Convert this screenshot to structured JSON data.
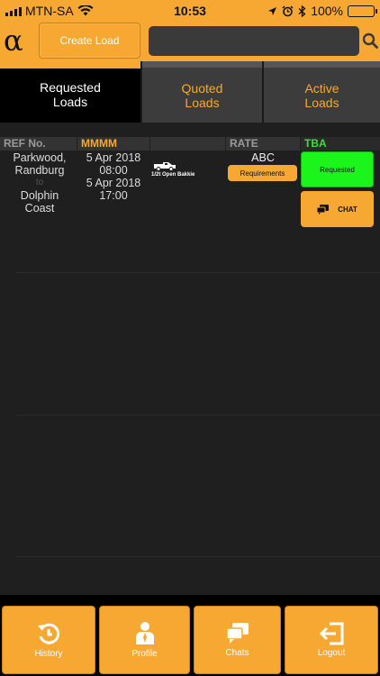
{
  "status_bar": {
    "carrier": "MTN-SA",
    "time": "10:53",
    "battery": "100%",
    "battery_level": 1.0
  },
  "header": {
    "logo": "α",
    "create_label": "Create Load",
    "search_placeholder": ""
  },
  "tabs": [
    {
      "label": "Requested Loads"
    },
    {
      "label": "Quoted Loads"
    },
    {
      "label": "Active Loads"
    }
  ],
  "table": {
    "headers": {
      "ref": "REF No.",
      "date": "MMMM",
      "rate": "RATE",
      "status": "TBA"
    },
    "row": {
      "from": "Parkwood, Randburg",
      "to_word": "to",
      "to": "Dolphin Coast",
      "date_from": "5 Apr 2018",
      "time_from": "08:00",
      "date_to": "5 Apr 2018",
      "time_to": "17:00",
      "vehicle": "1/2t Open Bakkie",
      "rate": "ABC",
      "requirements_label": "Requirements",
      "status_label": "Requested",
      "chat_label": "CHAT"
    }
  },
  "bottom_nav": {
    "history": "History",
    "profile": "Profile",
    "chats": "Chats",
    "logout": "Logout"
  },
  "colors": {
    "accent": "#f7a833",
    "status_green": "#1cf51c",
    "background": "#1f1f1f"
  }
}
